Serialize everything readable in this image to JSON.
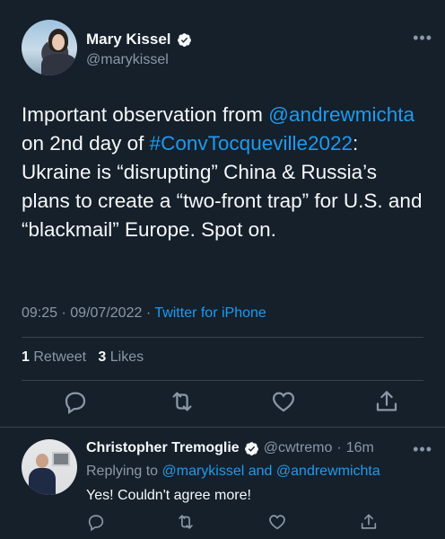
{
  "tweet": {
    "author_name": "Mary Kissel",
    "author_handle": "@marykissel",
    "more_label": "•••",
    "body_parts": [
      {
        "text": "Important observation from ",
        "link": false
      },
      {
        "text": "@andrewmichta",
        "link": true
      },
      {
        "text": " on 2nd day of ",
        "link": false
      },
      {
        "text": "#ConvTocqueville2022",
        "link": true
      },
      {
        "text": ": Ukraine is “disrupting” China & Russia’s plans to create a “two-front trap” for U.S. and “blackmail” Europe. Spot on.",
        "link": false
      }
    ],
    "time": "09:25",
    "date": "09/07/2022",
    "source": "Twitter for iPhone",
    "retweets_count": "1",
    "retweets_label": "Retweet",
    "likes_count": "3",
    "likes_label": "Likes"
  },
  "icons": [
    "reply-icon",
    "retweet-icon",
    "like-icon",
    "share-icon",
    "verified-badge-icon",
    "more-icon"
  ],
  "reply": {
    "author_name": "Christopher Tremoglie",
    "author_handle": "@cwtremo",
    "time_ago": "16m",
    "replying_prefix": "Replying to ",
    "replying_to_1": "@marykissel",
    "replying_and": " and ",
    "replying_to_2": "@andrewmichta",
    "text": "Yes! Couldn't agree more!"
  },
  "colors": {
    "background": "#15202b",
    "text": "#f7f9f9",
    "secondary": "#8b98a5",
    "link": "#1d9bf0",
    "divider": "#38444d"
  }
}
